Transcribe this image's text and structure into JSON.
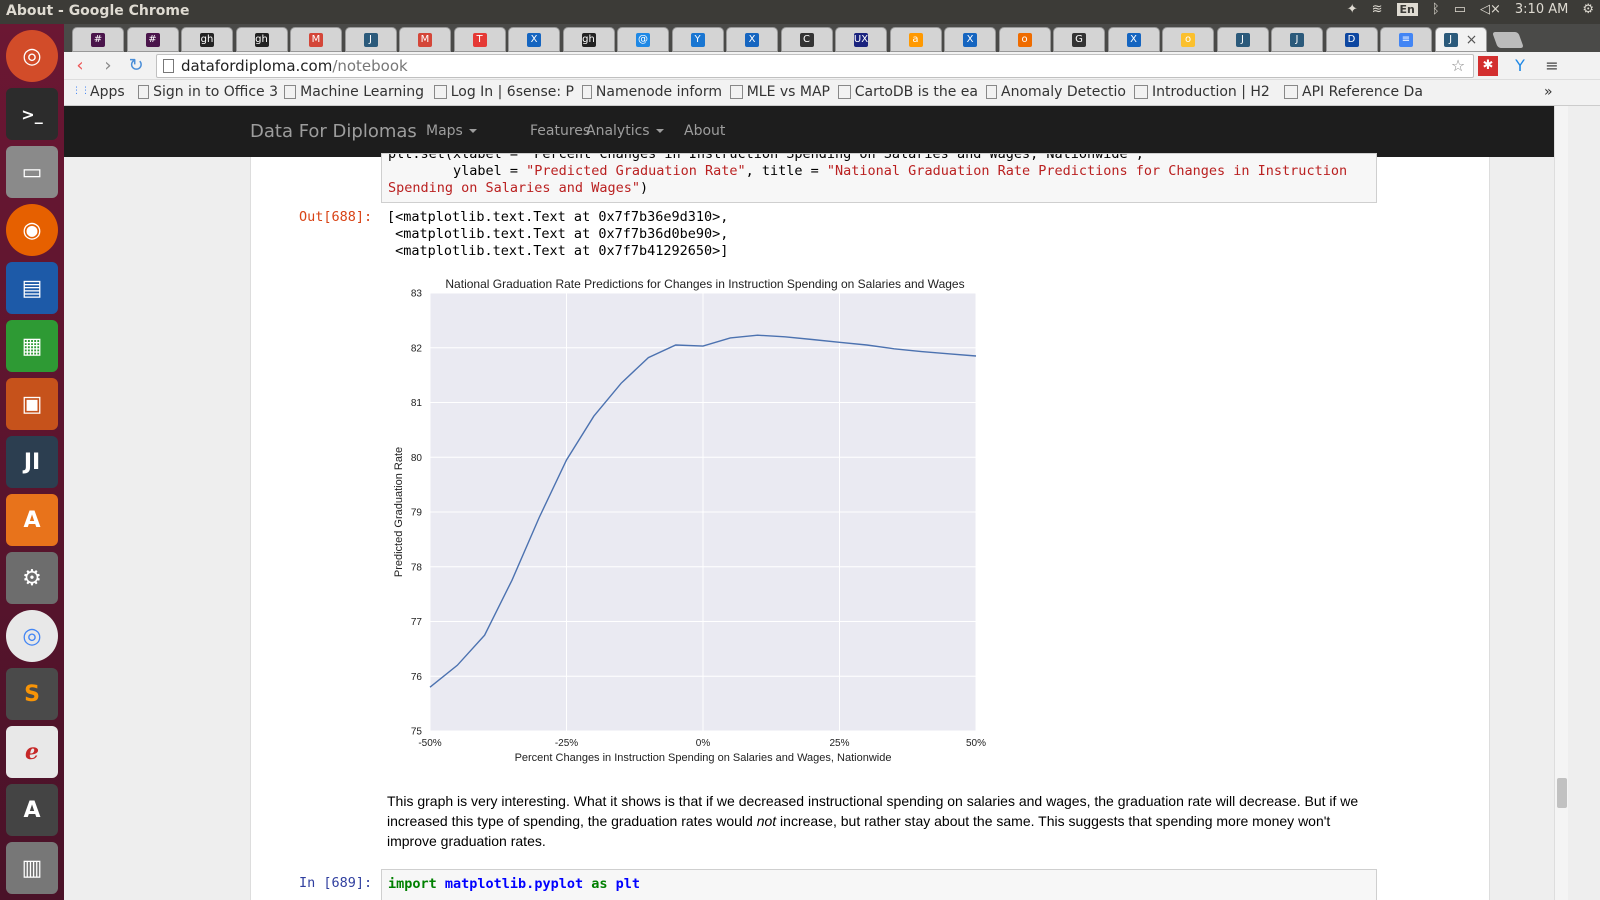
{
  "window": {
    "title": "About - Google Chrome",
    "clock": "3:10 AM",
    "lang": "En"
  },
  "tabs": [
    {
      "icon": "#",
      "color": "#4a154b"
    },
    {
      "icon": "#",
      "color": "#4a154b"
    },
    {
      "icon": "gh",
      "color": "#222222"
    },
    {
      "icon": "gh",
      "color": "#222222"
    },
    {
      "icon": "M",
      "color": "#d44638"
    },
    {
      "icon": "J",
      "color": "#2b5a7b"
    },
    {
      "icon": "M",
      "color": "#d44638"
    },
    {
      "icon": "T",
      "color": "#e53935"
    },
    {
      "icon": "X",
      "color": "#1565c0"
    },
    {
      "icon": "gh",
      "color": "#222222"
    },
    {
      "icon": "@",
      "color": "#1e88e5"
    },
    {
      "icon": "Y",
      "color": "#1976d2"
    },
    {
      "icon": "X",
      "color": "#1565c0"
    },
    {
      "icon": "C",
      "color": "#333333"
    },
    {
      "icon": "UX",
      "color": "#1a237e"
    },
    {
      "icon": "a",
      "color": "#ff9900"
    },
    {
      "icon": "X",
      "color": "#1565c0"
    },
    {
      "icon": "o",
      "color": "#ef6c00"
    },
    {
      "icon": "G",
      "color": "#333333"
    },
    {
      "icon": "X",
      "color": "#1565c0"
    },
    {
      "icon": "o",
      "color": "#fbc02d"
    },
    {
      "icon": "J",
      "color": "#2b5a7b"
    },
    {
      "icon": "J",
      "color": "#2b5a7b"
    },
    {
      "icon": "D",
      "color": "#0d47a1"
    },
    {
      "icon": "≡",
      "color": "#4285f4"
    },
    {
      "icon": "J",
      "color": "#2b5a7b",
      "active": true
    }
  ],
  "address": {
    "host": "datafordiploma.com",
    "path": "/notebook"
  },
  "bookmarks": [
    {
      "label": "Apps"
    },
    {
      "label": "Sign in to Office 3"
    },
    {
      "label": "Machine Learning"
    },
    {
      "label": "Log In | 6sense: P"
    },
    {
      "label": "Namenode inform"
    },
    {
      "label": "MLE vs MAP"
    },
    {
      "label": "CartoDB is the ea"
    },
    {
      "label": "Anomaly Detectio"
    },
    {
      "label": "Introduction | H2"
    },
    {
      "label": "API Reference Da"
    }
  ],
  "site_nav": {
    "brand": "Data For Diplomas",
    "items": [
      "Maps",
      "Features",
      "Analytics",
      "About"
    ]
  },
  "cell_top": {
    "line0": "plt.set(xlabel = \"Percent Changes in Instruction Spending on Salaries and Wages, Nationwide\",",
    "line1_pre": "        ylabel = ",
    "line1_str1": "\"Predicted Graduation Rate\"",
    "line1_mid": ", title = ",
    "line1_str2": "\"National Graduation Rate Predictions for Changes in Instruction",
    "line2_str": "Spending on Salaries and Wages\"",
    "line2_post": ")"
  },
  "output": {
    "prompt": "Out[688]:",
    "lines": [
      "[<matplotlib.text.Text at 0x7f7b36e9d310>,",
      " <matplotlib.text.Text at 0x7f7b36d0be90>,",
      " <matplotlib.text.Text at 0x7f7b41292650>]"
    ]
  },
  "chart_data": {
    "type": "line",
    "title": "National Graduation Rate Predictions for Changes in Instruction Spending on Salaries and Wages",
    "xlabel": "Percent Changes in Instruction Spending on Salaries and Wages, Nationwide",
    "ylabel": "Predicted Graduation Rate",
    "xlim": [
      -50,
      50
    ],
    "ylim": [
      75,
      83
    ],
    "xticks": [
      -50,
      -25,
      0,
      25,
      50
    ],
    "xtick_labels": [
      "-50%",
      "-25%",
      "0%",
      "25%",
      "50%"
    ],
    "yticks": [
      75,
      76,
      77,
      78,
      79,
      80,
      81,
      82,
      83
    ],
    "grid": true,
    "x": [
      -50,
      -45,
      -40,
      -35,
      -30,
      -25,
      -20,
      -15,
      -10,
      -5,
      0,
      5,
      10,
      15,
      20,
      25,
      30,
      35,
      40,
      45,
      50
    ],
    "y": [
      75.8,
      76.2,
      76.75,
      77.75,
      78.9,
      79.95,
      80.75,
      81.35,
      81.82,
      82.05,
      82.03,
      82.18,
      82.23,
      82.2,
      82.15,
      82.1,
      82.05,
      81.98,
      81.93,
      81.89,
      81.85
    ],
    "line_color": "#4c72b0",
    "background": "#eaeaf2"
  },
  "explanation": {
    "part1": "This graph is very interesting. What it shows is that if we decreased instructional spending on salaries and wages, the graduation rate will decrease. But if we increased this type of spending, the graduation rates would ",
    "emph": "not",
    "part2": " increase, but rather stay about the same. This suggests that spending more money won't improve graduation rates."
  },
  "cell_bottom": {
    "prompt": "In [689]:",
    "code_kw1": "import",
    "code_mod": " matplotlib.pyplot ",
    "code_kw2": "as",
    "code_alias": " plt"
  }
}
